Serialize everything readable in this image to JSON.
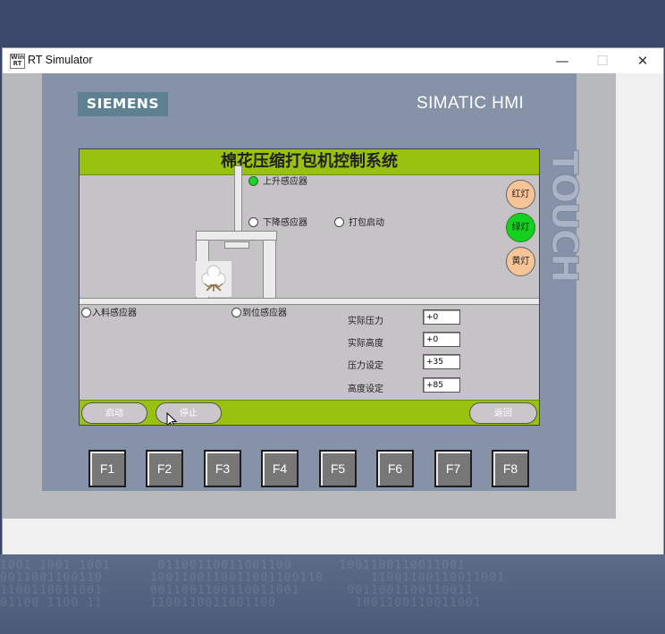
{
  "window": {
    "title": "RT Simulator",
    "controls": {
      "minimize": "—",
      "maximize": "☐",
      "close": "✕"
    }
  },
  "panel": {
    "brand": "SIEMENS",
    "model": "SIMATIC HMI",
    "side_label": "TOUCH"
  },
  "screen": {
    "title": "棉花压缩打包机控制系统",
    "sensors": {
      "rise": {
        "label": "上升感应器",
        "active": true
      },
      "lower": {
        "label": "下降感应器",
        "active": false
      },
      "pack_start": {
        "label": "打包启动",
        "active": false
      },
      "feed": {
        "label": "入料感应器",
        "active": false
      },
      "in_place": {
        "label": "到位感应器",
        "active": false
      }
    },
    "lamps": [
      {
        "label": "红灯",
        "color": "#f7c497",
        "active": false
      },
      {
        "label": "绿灯",
        "color": "#12d21f",
        "active": true
      },
      {
        "label": "黄灯",
        "color": "#f7c497",
        "active": false
      }
    ],
    "fields": [
      {
        "label": "实际压力",
        "value": "+0"
      },
      {
        "label": "实际高度",
        "value": "+0"
      },
      {
        "label": "压力设定",
        "value": "+35"
      },
      {
        "label": "高度设定",
        "value": "+85"
      }
    ],
    "buttons": {
      "start": "启动",
      "stop": "停止",
      "back": "返回"
    }
  },
  "function_keys": [
    "F1",
    "F2",
    "F3",
    "F4",
    "F5",
    "F6",
    "F7",
    "F8"
  ],
  "colors": {
    "accent_bar": "#99c20f",
    "screen_bg": "#c6c3c6",
    "panel": "#8592a7",
    "brand_logo": "#5e8191"
  }
}
